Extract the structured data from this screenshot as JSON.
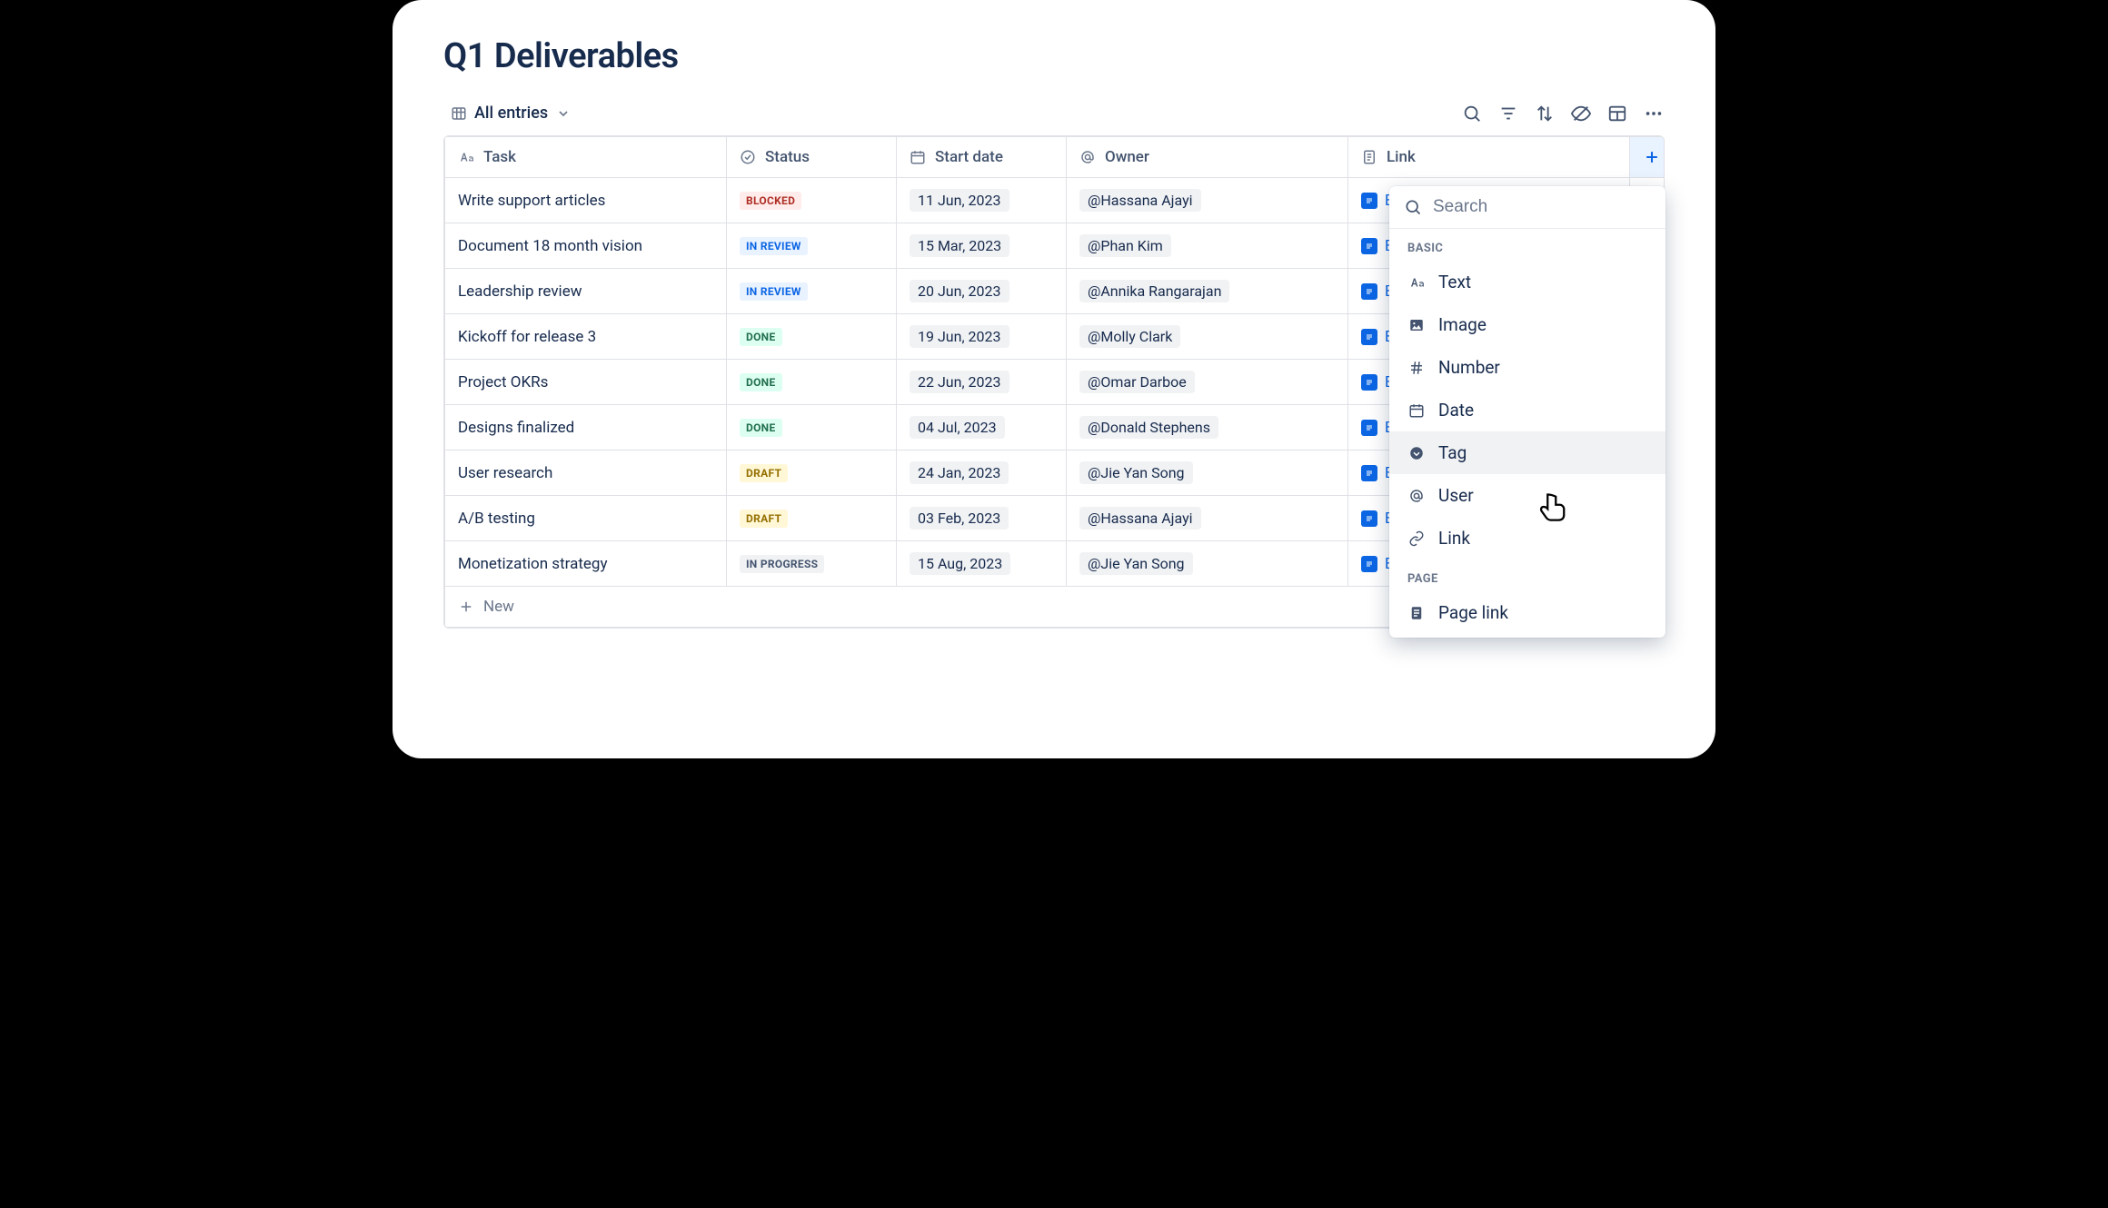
{
  "page": {
    "title": "Q1 Deliverables",
    "view_label": "All entries",
    "new_row_label": "New"
  },
  "columns": {
    "task": "Task",
    "status": "Status",
    "date": "Start date",
    "owner": "Owner",
    "link": "Link"
  },
  "rows": [
    {
      "task": "Write support articles",
      "status": "BLOCKED",
      "date": "11 Jun, 2023",
      "owner": "Hassana Ajayi"
    },
    {
      "task": "Document 18 month vision",
      "status": "IN REVIEW",
      "date": "15 Mar, 2023",
      "owner": "Phan Kim"
    },
    {
      "task": "Leadership review",
      "status": "IN REVIEW",
      "date": "20 Jun, 2023",
      "owner": "Annika Rangarajan"
    },
    {
      "task": "Kickoff for release 3",
      "status": "DONE",
      "date": "19 Jun, 2023",
      "owner": "Molly Clark"
    },
    {
      "task": "Project OKRs",
      "status": "DONE",
      "date": "22 Jun, 2023",
      "owner": "Omar Darboe"
    },
    {
      "task": "Designs finalized",
      "status": "DONE",
      "date": "04 Jul, 2023",
      "owner": "Donald Stephens"
    },
    {
      "task": "User research",
      "status": "DRAFT",
      "date": "24 Jan, 2023",
      "owner": "Jie Yan Song"
    },
    {
      "task": "A/B testing",
      "status": "DRAFT",
      "date": "03 Feb, 2023",
      "owner": "Hassana Ajayi"
    },
    {
      "task": "Monetization strategy",
      "status": "IN PROGRESS",
      "date": "15 Aug, 2023",
      "owner": "Jie Yan Song"
    }
  ],
  "dropdown": {
    "search_placeholder": "Search",
    "sections": {
      "basic": "BASIC",
      "page": "PAGE"
    },
    "items": {
      "text": "Text",
      "image": "Image",
      "number": "Number",
      "date": "Date",
      "tag": "Tag",
      "user": "User",
      "link": "Link",
      "pagelink": "Page link"
    }
  }
}
